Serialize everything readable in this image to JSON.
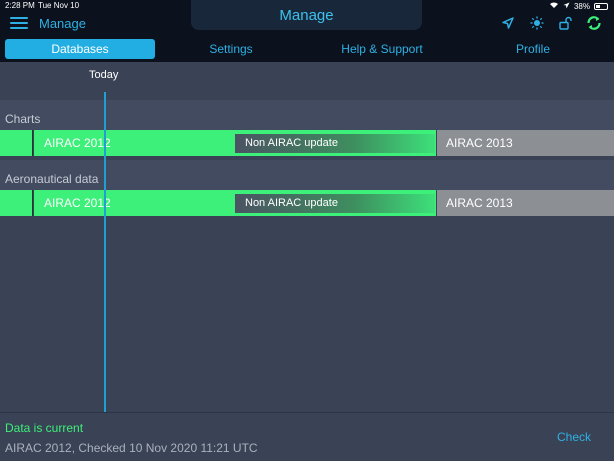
{
  "statusbar": {
    "time": "2:28 PM",
    "date": "Tue Nov 10",
    "battery": "38%"
  },
  "header": {
    "back_label": "Manage",
    "title": "Manage",
    "icons": [
      "menu-icon",
      "location-arrow-icon",
      "brightness-icon",
      "unlock-icon",
      "sync-icon"
    ]
  },
  "tabs": [
    {
      "label": "Databases",
      "active": true
    },
    {
      "label": "Settings",
      "active": false
    },
    {
      "label": "Help & Support",
      "active": false
    },
    {
      "label": "Profile",
      "active": false
    }
  ],
  "timeline": {
    "today_label": "Today",
    "sections": [
      {
        "label": "Charts",
        "current": "AIRAC 2012",
        "non_airac": "Non AIRAC update",
        "next": "AIRAC 2013"
      },
      {
        "label": "Aeronautical data",
        "current": "AIRAC 2012",
        "non_airac": "Non AIRAC update",
        "next": "AIRAC 2013"
      }
    ]
  },
  "footer": {
    "status": "Data is current",
    "detail": "AIRAC 2012, Checked 10 Nov 2020 11:21 UTC",
    "check_label": "Check"
  },
  "colors": {
    "accent": "#2fb0e4",
    "current_green": "#3df07a",
    "next_gray": "#8c8f94",
    "background": "#3a4255"
  }
}
